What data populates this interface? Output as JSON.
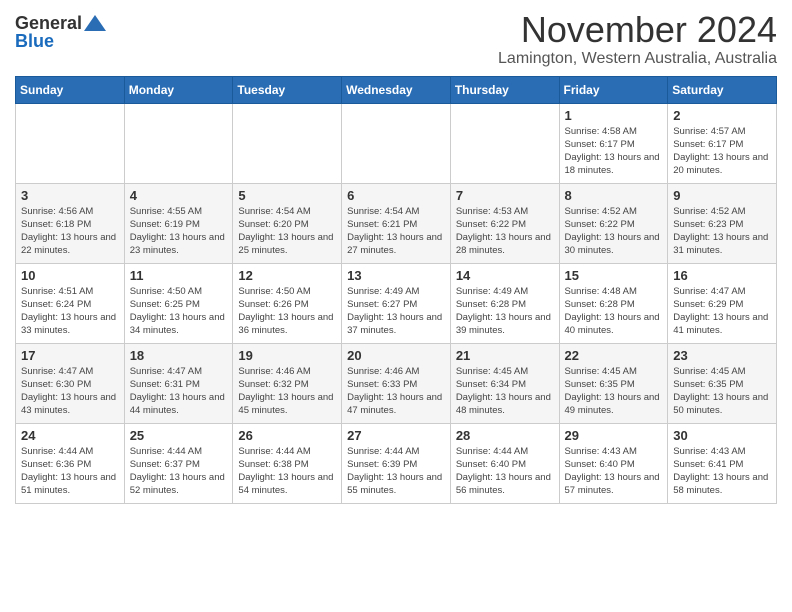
{
  "logo": {
    "general": "General",
    "blue": "Blue"
  },
  "header": {
    "month": "November 2024",
    "location": "Lamington, Western Australia, Australia"
  },
  "weekdays": [
    "Sunday",
    "Monday",
    "Tuesday",
    "Wednesday",
    "Thursday",
    "Friday",
    "Saturday"
  ],
  "weeks": [
    [
      {
        "day": "",
        "sunrise": "",
        "sunset": "",
        "daylight": ""
      },
      {
        "day": "",
        "sunrise": "",
        "sunset": "",
        "daylight": ""
      },
      {
        "day": "",
        "sunrise": "",
        "sunset": "",
        "daylight": ""
      },
      {
        "day": "",
        "sunrise": "",
        "sunset": "",
        "daylight": ""
      },
      {
        "day": "",
        "sunrise": "",
        "sunset": "",
        "daylight": ""
      },
      {
        "day": "1",
        "sunrise": "Sunrise: 4:58 AM",
        "sunset": "Sunset: 6:17 PM",
        "daylight": "Daylight: 13 hours and 18 minutes."
      },
      {
        "day": "2",
        "sunrise": "Sunrise: 4:57 AM",
        "sunset": "Sunset: 6:17 PM",
        "daylight": "Daylight: 13 hours and 20 minutes."
      }
    ],
    [
      {
        "day": "3",
        "sunrise": "Sunrise: 4:56 AM",
        "sunset": "Sunset: 6:18 PM",
        "daylight": "Daylight: 13 hours and 22 minutes."
      },
      {
        "day": "4",
        "sunrise": "Sunrise: 4:55 AM",
        "sunset": "Sunset: 6:19 PM",
        "daylight": "Daylight: 13 hours and 23 minutes."
      },
      {
        "day": "5",
        "sunrise": "Sunrise: 4:54 AM",
        "sunset": "Sunset: 6:20 PM",
        "daylight": "Daylight: 13 hours and 25 minutes."
      },
      {
        "day": "6",
        "sunrise": "Sunrise: 4:54 AM",
        "sunset": "Sunset: 6:21 PM",
        "daylight": "Daylight: 13 hours and 27 minutes."
      },
      {
        "day": "7",
        "sunrise": "Sunrise: 4:53 AM",
        "sunset": "Sunset: 6:22 PM",
        "daylight": "Daylight: 13 hours and 28 minutes."
      },
      {
        "day": "8",
        "sunrise": "Sunrise: 4:52 AM",
        "sunset": "Sunset: 6:22 PM",
        "daylight": "Daylight: 13 hours and 30 minutes."
      },
      {
        "day": "9",
        "sunrise": "Sunrise: 4:52 AM",
        "sunset": "Sunset: 6:23 PM",
        "daylight": "Daylight: 13 hours and 31 minutes."
      }
    ],
    [
      {
        "day": "10",
        "sunrise": "Sunrise: 4:51 AM",
        "sunset": "Sunset: 6:24 PM",
        "daylight": "Daylight: 13 hours and 33 minutes."
      },
      {
        "day": "11",
        "sunrise": "Sunrise: 4:50 AM",
        "sunset": "Sunset: 6:25 PM",
        "daylight": "Daylight: 13 hours and 34 minutes."
      },
      {
        "day": "12",
        "sunrise": "Sunrise: 4:50 AM",
        "sunset": "Sunset: 6:26 PM",
        "daylight": "Daylight: 13 hours and 36 minutes."
      },
      {
        "day": "13",
        "sunrise": "Sunrise: 4:49 AM",
        "sunset": "Sunset: 6:27 PM",
        "daylight": "Daylight: 13 hours and 37 minutes."
      },
      {
        "day": "14",
        "sunrise": "Sunrise: 4:49 AM",
        "sunset": "Sunset: 6:28 PM",
        "daylight": "Daylight: 13 hours and 39 minutes."
      },
      {
        "day": "15",
        "sunrise": "Sunrise: 4:48 AM",
        "sunset": "Sunset: 6:28 PM",
        "daylight": "Daylight: 13 hours and 40 minutes."
      },
      {
        "day": "16",
        "sunrise": "Sunrise: 4:47 AM",
        "sunset": "Sunset: 6:29 PM",
        "daylight": "Daylight: 13 hours and 41 minutes."
      }
    ],
    [
      {
        "day": "17",
        "sunrise": "Sunrise: 4:47 AM",
        "sunset": "Sunset: 6:30 PM",
        "daylight": "Daylight: 13 hours and 43 minutes."
      },
      {
        "day": "18",
        "sunrise": "Sunrise: 4:47 AM",
        "sunset": "Sunset: 6:31 PM",
        "daylight": "Daylight: 13 hours and 44 minutes."
      },
      {
        "day": "19",
        "sunrise": "Sunrise: 4:46 AM",
        "sunset": "Sunset: 6:32 PM",
        "daylight": "Daylight: 13 hours and 45 minutes."
      },
      {
        "day": "20",
        "sunrise": "Sunrise: 4:46 AM",
        "sunset": "Sunset: 6:33 PM",
        "daylight": "Daylight: 13 hours and 47 minutes."
      },
      {
        "day": "21",
        "sunrise": "Sunrise: 4:45 AM",
        "sunset": "Sunset: 6:34 PM",
        "daylight": "Daylight: 13 hours and 48 minutes."
      },
      {
        "day": "22",
        "sunrise": "Sunrise: 4:45 AM",
        "sunset": "Sunset: 6:35 PM",
        "daylight": "Daylight: 13 hours and 49 minutes."
      },
      {
        "day": "23",
        "sunrise": "Sunrise: 4:45 AM",
        "sunset": "Sunset: 6:35 PM",
        "daylight": "Daylight: 13 hours and 50 minutes."
      }
    ],
    [
      {
        "day": "24",
        "sunrise": "Sunrise: 4:44 AM",
        "sunset": "Sunset: 6:36 PM",
        "daylight": "Daylight: 13 hours and 51 minutes."
      },
      {
        "day": "25",
        "sunrise": "Sunrise: 4:44 AM",
        "sunset": "Sunset: 6:37 PM",
        "daylight": "Daylight: 13 hours and 52 minutes."
      },
      {
        "day": "26",
        "sunrise": "Sunrise: 4:44 AM",
        "sunset": "Sunset: 6:38 PM",
        "daylight": "Daylight: 13 hours and 54 minutes."
      },
      {
        "day": "27",
        "sunrise": "Sunrise: 4:44 AM",
        "sunset": "Sunset: 6:39 PM",
        "daylight": "Daylight: 13 hours and 55 minutes."
      },
      {
        "day": "28",
        "sunrise": "Sunrise: 4:44 AM",
        "sunset": "Sunset: 6:40 PM",
        "daylight": "Daylight: 13 hours and 56 minutes."
      },
      {
        "day": "29",
        "sunrise": "Sunrise: 4:43 AM",
        "sunset": "Sunset: 6:40 PM",
        "daylight": "Daylight: 13 hours and 57 minutes."
      },
      {
        "day": "30",
        "sunrise": "Sunrise: 4:43 AM",
        "sunset": "Sunset: 6:41 PM",
        "daylight": "Daylight: 13 hours and 58 minutes."
      }
    ]
  ]
}
